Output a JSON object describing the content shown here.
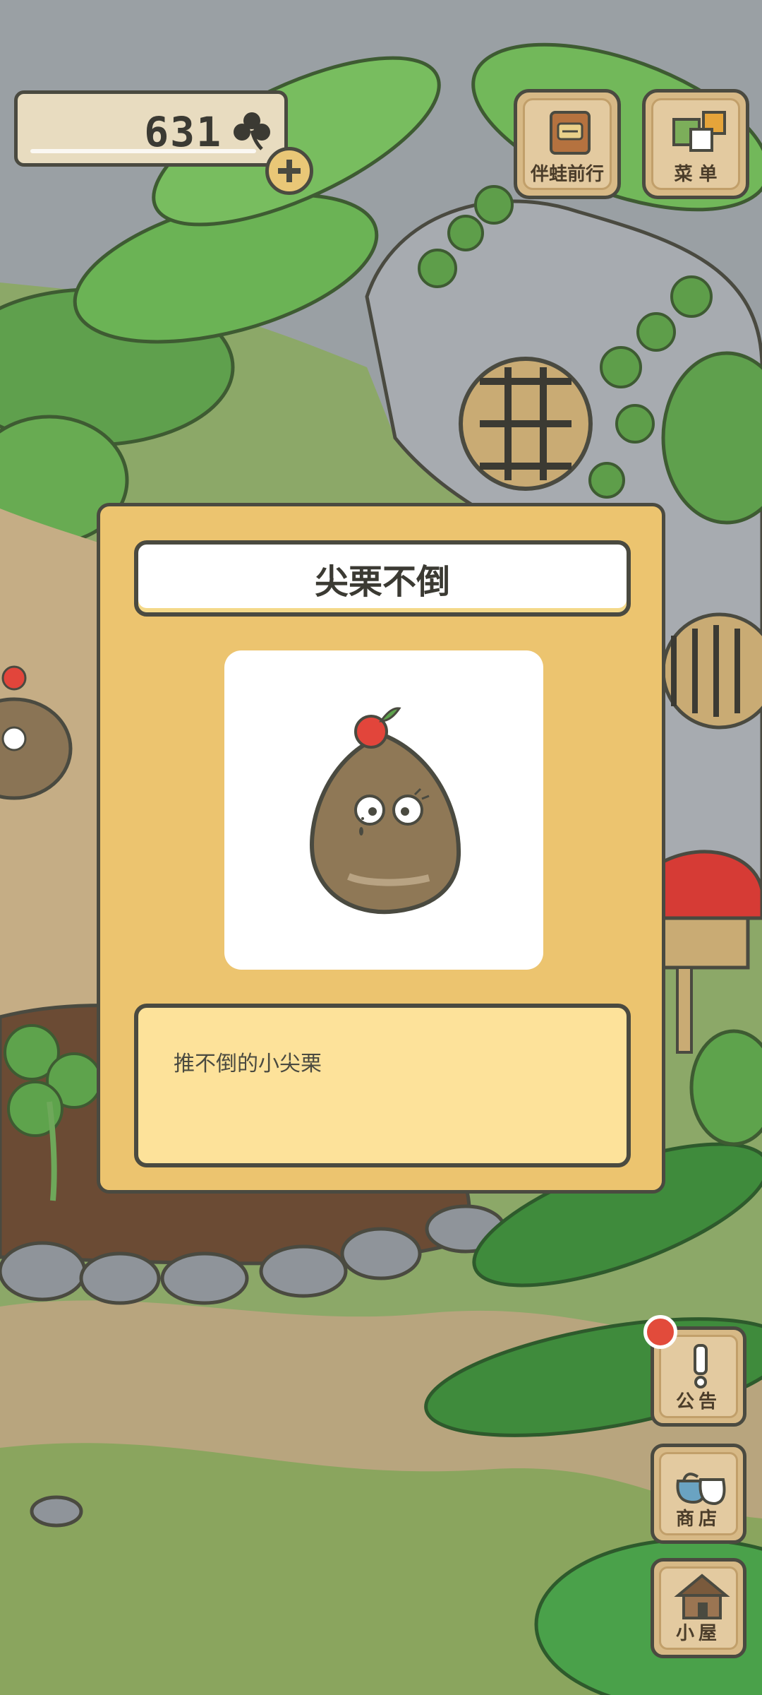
{
  "hud": {
    "clover_count": "631"
  },
  "top_buttons": [
    {
      "label": "伴蛙前行",
      "icon": "album-book-icon"
    },
    {
      "label": "菜 单",
      "icon": "menu-cards-icon"
    }
  ],
  "side_buttons": [
    {
      "label": "公告",
      "icon": "exclamation-icon"
    },
    {
      "label": "商店",
      "icon": "shop-bags-icon"
    },
    {
      "label": "小屋",
      "icon": "house-icon"
    }
  ],
  "item_popup": {
    "title": "尖栗不倒",
    "description": "推不倒的小尖栗",
    "item_icon": "chestnut-doll-icon"
  },
  "colors": {
    "popup_bg": "#ecc46f",
    "desc_bg": "#fde29a",
    "outline": "#4a4a40",
    "notification": "#e24b3b"
  }
}
